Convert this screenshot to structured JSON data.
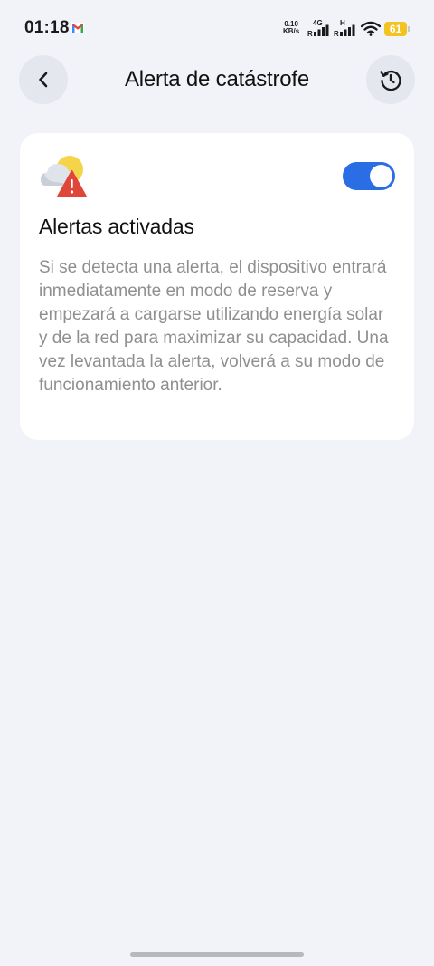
{
  "status_bar": {
    "time": "01:18",
    "net_speed_value": "0.10",
    "net_speed_unit": "KB/s",
    "sim1_type": "4G",
    "sim2_type": "H",
    "battery_level": "61",
    "battery_color": "#f2c41f",
    "icons": [
      "gmail-icon",
      "signal-icon",
      "wifi-icon",
      "battery-icon"
    ]
  },
  "header": {
    "title": "Alerta de catástrofe",
    "back_icon": "chevron-left-icon",
    "history_icon": "history-icon"
  },
  "card": {
    "icon": "weather-alert-icon",
    "toggle_on": true,
    "accent_color": "#2a6de5",
    "title": "Alertas activadas",
    "description": "Si se detecta una alerta, el dispositivo entrará inmediatamente en modo de reserva y empezará a cargarse utilizando energía solar y de la red para maximizar su capacidad. Una vez levantada la alerta, volverá a su modo de funcionamiento anterior."
  }
}
